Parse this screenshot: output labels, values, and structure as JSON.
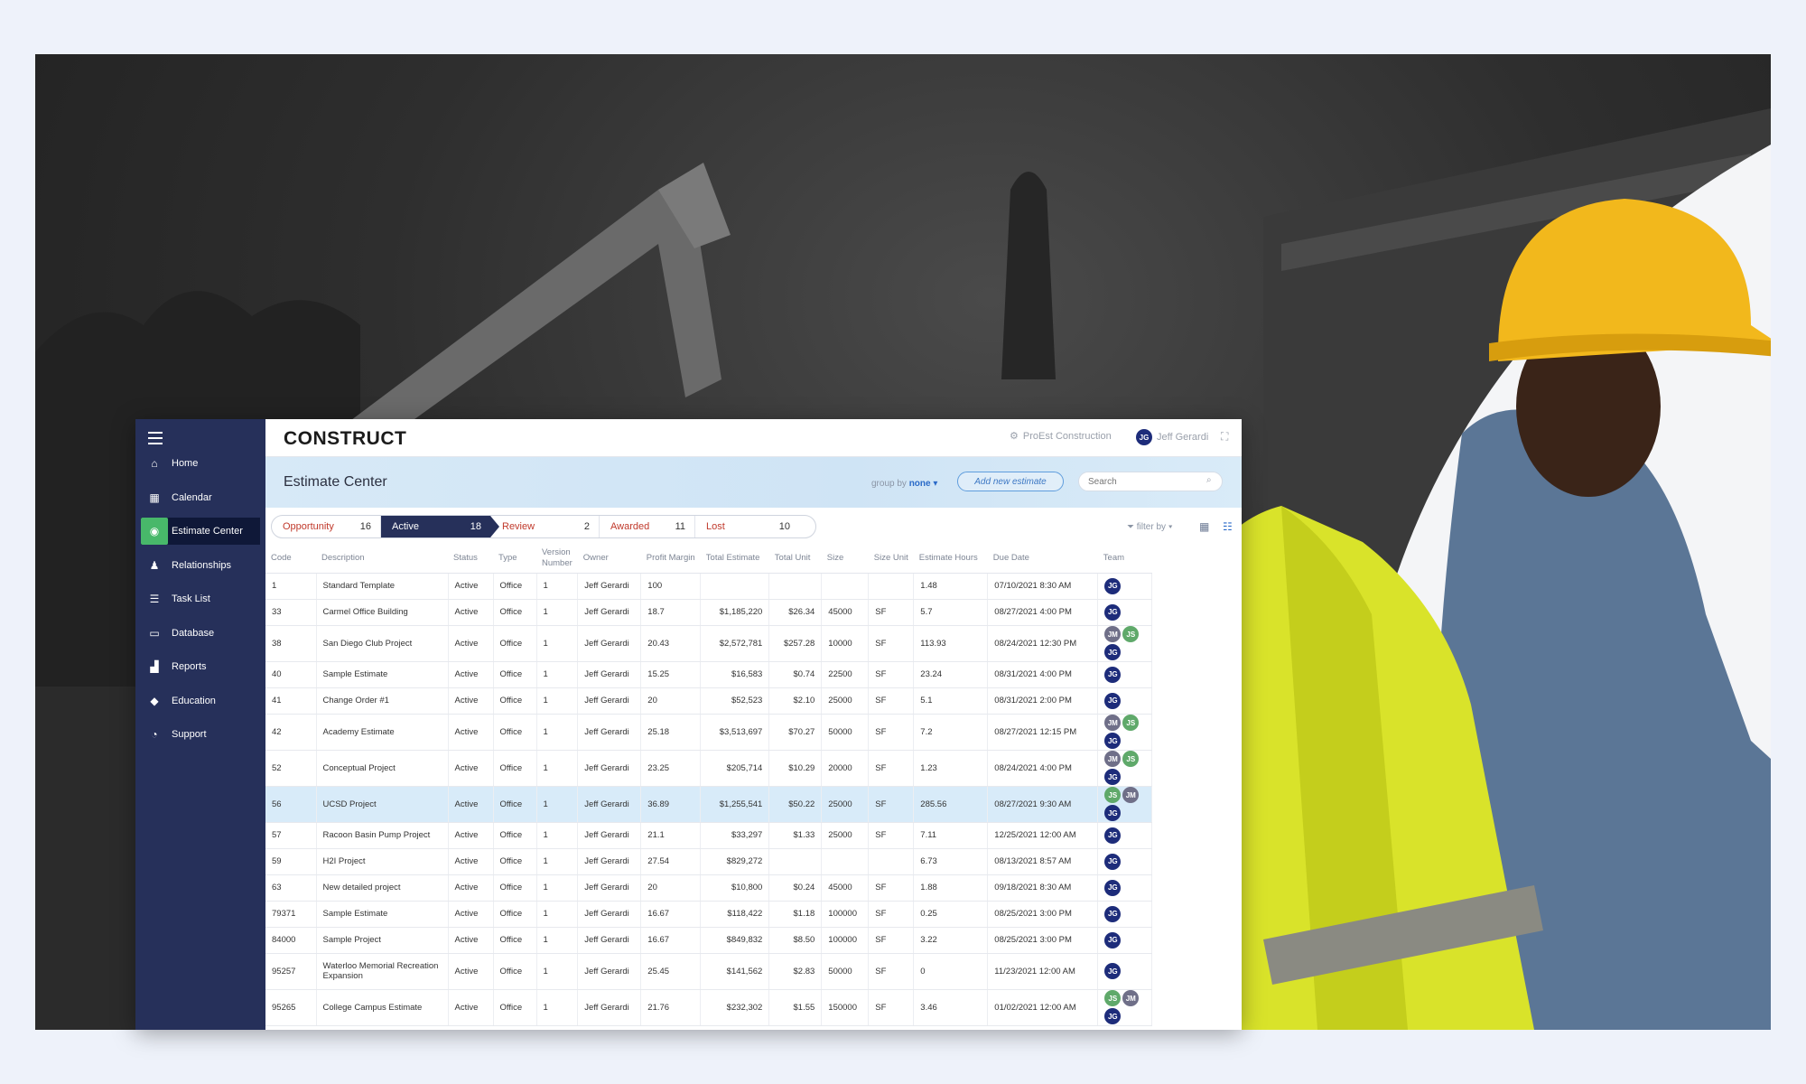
{
  "app": {
    "logo": "CONSTRUCT",
    "company": "ProEst Construction",
    "user_initials": "JG",
    "user_name": "Jeff Gerardi"
  },
  "sidebar": {
    "items": [
      {
        "label": "Home",
        "icon": "home-icon",
        "glyph": "⌂"
      },
      {
        "label": "Calendar",
        "icon": "calendar-icon",
        "glyph": "▦"
      },
      {
        "label": "Estimate Center",
        "icon": "estimate-center-icon",
        "glyph": "◉",
        "active": true
      },
      {
        "label": "Relationships",
        "icon": "people-icon",
        "glyph": "♟"
      },
      {
        "label": "Task List",
        "icon": "task-list-icon",
        "glyph": "☰"
      },
      {
        "label": "Database",
        "icon": "database-icon",
        "glyph": "▭"
      },
      {
        "label": "Reports",
        "icon": "reports-icon",
        "glyph": "▟"
      },
      {
        "label": "Education",
        "icon": "education-icon",
        "glyph": "◆"
      },
      {
        "label": "Support",
        "icon": "support-icon",
        "glyph": "◔"
      }
    ]
  },
  "header": {
    "title": "Estimate Center",
    "group_by_label": "group by",
    "group_by_value": "none",
    "add_button": "Add new estimate",
    "search_placeholder": "Search"
  },
  "status_tabs": [
    {
      "label": "Opportunity",
      "count": "16"
    },
    {
      "label": "Active",
      "count": "18",
      "active": true
    },
    {
      "label": "Review",
      "count": "2"
    },
    {
      "label": "Awarded",
      "count": "11"
    },
    {
      "label": "Lost",
      "count": "10"
    }
  ],
  "filter_label": "filter by",
  "table": {
    "columns": [
      "Code",
      "Description",
      "Status",
      "Type",
      "Version Number",
      "Owner",
      "Profit Margin",
      "Total Estimate",
      "Total Unit",
      "Size",
      "Size Unit",
      "Estimate Hours",
      "Due Date",
      "Team"
    ],
    "rows": [
      {
        "code": "1",
        "desc": "Standard Template",
        "status": "Active",
        "type": "Office",
        "version": "1",
        "owner": "Jeff Gerardi",
        "margin": "100",
        "total": "",
        "unit": "",
        "size": "",
        "size_unit": "",
        "hours": "1.48",
        "due": "07/10/2021 8:30 AM",
        "team": [
          "JG"
        ]
      },
      {
        "code": "33",
        "desc": "Carmel Office Building",
        "status": "Active",
        "type": "Office",
        "version": "1",
        "owner": "Jeff Gerardi",
        "margin": "18.7",
        "total": "$1,185,220",
        "unit": "$26.34",
        "size": "45000",
        "size_unit": "SF",
        "hours": "5.7",
        "due": "08/27/2021 4:00 PM",
        "team": [
          "JG"
        ]
      },
      {
        "code": "38",
        "desc": "San Diego Club Project",
        "status": "Active",
        "type": "Office",
        "version": "1",
        "owner": "Jeff Gerardi",
        "margin": "20.43",
        "total": "$2,572,781",
        "unit": "$257.28",
        "size": "10000",
        "size_unit": "SF",
        "hours": "113.93",
        "due": "08/24/2021 12:30 PM",
        "team": [
          "JM",
          "JS",
          "JG"
        ]
      },
      {
        "code": "40",
        "desc": "Sample Estimate",
        "status": "Active",
        "type": "Office",
        "version": "1",
        "owner": "Jeff Gerardi",
        "margin": "15.25",
        "total": "$16,583",
        "unit": "$0.74",
        "size": "22500",
        "size_unit": "SF",
        "hours": "23.24",
        "due": "08/31/2021 4:00 PM",
        "team": [
          "JG"
        ]
      },
      {
        "code": "41",
        "desc": "Change Order #1",
        "status": "Active",
        "type": "Office",
        "version": "1",
        "owner": "Jeff Gerardi",
        "margin": "20",
        "total": "$52,523",
        "unit": "$2.10",
        "size": "25000",
        "size_unit": "SF",
        "hours": "5.1",
        "due": "08/31/2021 2:00 PM",
        "team": [
          "JG"
        ]
      },
      {
        "code": "42",
        "desc": "Academy Estimate",
        "status": "Active",
        "type": "Office",
        "version": "1",
        "owner": "Jeff Gerardi",
        "margin": "25.18",
        "total": "$3,513,697",
        "unit": "$70.27",
        "size": "50000",
        "size_unit": "SF",
        "hours": "7.2",
        "due": "08/27/2021 12:15 PM",
        "team": [
          "JM",
          "JS",
          "JG"
        ]
      },
      {
        "code": "52",
        "desc": "Conceptual Project",
        "status": "Active",
        "type": "Office",
        "version": "1",
        "owner": "Jeff Gerardi",
        "margin": "23.25",
        "total": "$205,714",
        "unit": "$10.29",
        "size": "20000",
        "size_unit": "SF",
        "hours": "1.23",
        "due": "08/24/2021 4:00 PM",
        "team": [
          "JM",
          "JS",
          "JG"
        ]
      },
      {
        "code": "56",
        "desc": "UCSD Project",
        "status": "Active",
        "type": "Office",
        "version": "1",
        "owner": "Jeff Gerardi",
        "margin": "36.89",
        "total": "$1,255,541",
        "unit": "$50.22",
        "size": "25000",
        "size_unit": "SF",
        "hours": "285.56",
        "due": "08/27/2021 9:30 AM",
        "team": [
          "JS",
          "JM",
          "JG"
        ],
        "highlighted": true
      },
      {
        "code": "57",
        "desc": "Racoon Basin Pump Project",
        "status": "Active",
        "type": "Office",
        "version": "1",
        "owner": "Jeff Gerardi",
        "margin": "21.1",
        "total": "$33,297",
        "unit": "$1.33",
        "size": "25000",
        "size_unit": "SF",
        "hours": "7.11",
        "due": "12/25/2021 12:00 AM",
        "team": [
          "JG"
        ]
      },
      {
        "code": "59",
        "desc": "H2I Project",
        "status": "Active",
        "type": "Office",
        "version": "1",
        "owner": "Jeff Gerardi",
        "margin": "27.54",
        "total": "$829,272",
        "unit": "",
        "size": "",
        "size_unit": "",
        "hours": "6.73",
        "due": "08/13/2021 8:57 AM",
        "team": [
          "JG"
        ]
      },
      {
        "code": "63",
        "desc": "New detailed project",
        "status": "Active",
        "type": "Office",
        "version": "1",
        "owner": "Jeff Gerardi",
        "margin": "20",
        "total": "$10,800",
        "unit": "$0.24",
        "size": "45000",
        "size_unit": "SF",
        "hours": "1.88",
        "due": "09/18/2021 8:30 AM",
        "team": [
          "JG"
        ]
      },
      {
        "code": "79371",
        "desc": "Sample Estimate",
        "status": "Active",
        "type": "Office",
        "version": "1",
        "owner": "Jeff Gerardi",
        "margin": "16.67",
        "total": "$118,422",
        "unit": "$1.18",
        "size": "100000",
        "size_unit": "SF",
        "hours": "0.25",
        "due": "08/25/2021 3:00 PM",
        "team": [
          "JG"
        ]
      },
      {
        "code": "84000",
        "desc": "Sample Project",
        "status": "Active",
        "type": "Office",
        "version": "1",
        "owner": "Jeff Gerardi",
        "margin": "16.67",
        "total": "$849,832",
        "unit": "$8.50",
        "size": "100000",
        "size_unit": "SF",
        "hours": "3.22",
        "due": "08/25/2021 3:00 PM",
        "team": [
          "JG"
        ]
      },
      {
        "code": "95257",
        "desc": "Waterloo Memorial Recreation Expansion",
        "status": "Active",
        "type": "Office",
        "version": "1",
        "owner": "Jeff Gerardi",
        "margin": "25.45",
        "total": "$141,562",
        "unit": "$2.83",
        "size": "50000",
        "size_unit": "SF",
        "hours": "0",
        "due": "11/23/2021 12:00 AM",
        "team": [
          "JG"
        ]
      },
      {
        "code": "95265",
        "desc": "College Campus Estimate",
        "status": "Active",
        "type": "Office",
        "version": "1",
        "owner": "Jeff Gerardi",
        "margin": "21.76",
        "total": "$232,302",
        "unit": "$1.55",
        "size": "150000",
        "size_unit": "SF",
        "hours": "3.46",
        "due": "01/02/2021 12:00 AM",
        "team": [
          "JS",
          "JM",
          "JG"
        ]
      }
    ]
  },
  "colors": {
    "sidebar": "#26305a",
    "active_nav_icon": "#48b86a",
    "tab_text": "#c0392b",
    "highlight_row": "#d8ebf9",
    "accent": "#2a6ac8"
  }
}
